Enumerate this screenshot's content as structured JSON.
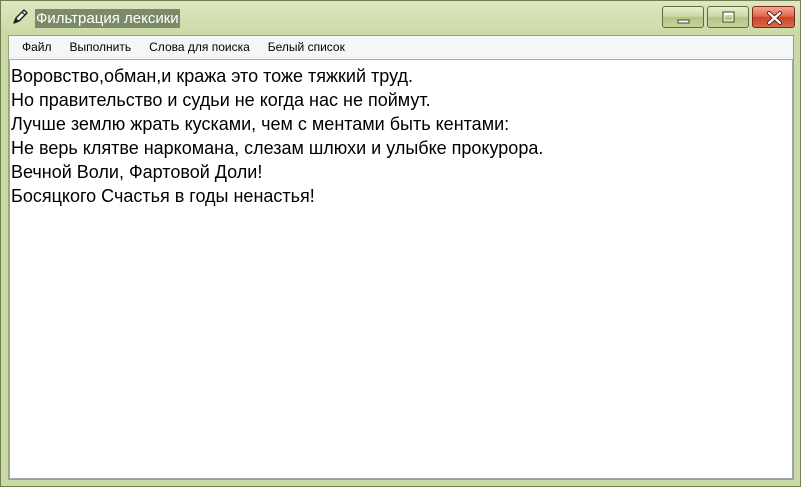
{
  "window": {
    "title": "Фильтрация лексики"
  },
  "menu": {
    "items": [
      "Файл",
      "Выполнить",
      "Слова для поиска",
      "Белый список"
    ]
  },
  "editor": {
    "lines": [
      "Воровство,обман,и кража это тоже тяжкий труд.",
      "Но правительство и судьи не когда нас не поймут.",
      "Лучше землю жрать кусками, чем с ментами быть кентами:",
      "Не верь клятве наркомана, слезам шлюхи и улыбке прокурора.",
      "Вечной Воли, Фартовой Доли!",
      "Босяцкого Счастья в годы ненастья!"
    ]
  },
  "icons": {
    "app": "pencil-icon",
    "minimize": "minimize-icon",
    "maximize": "maximize-icon",
    "close": "close-icon"
  },
  "colors": {
    "frame": "#cbd9a6",
    "title_highlight": "#7c8b67",
    "close_button": "#d9583c"
  }
}
